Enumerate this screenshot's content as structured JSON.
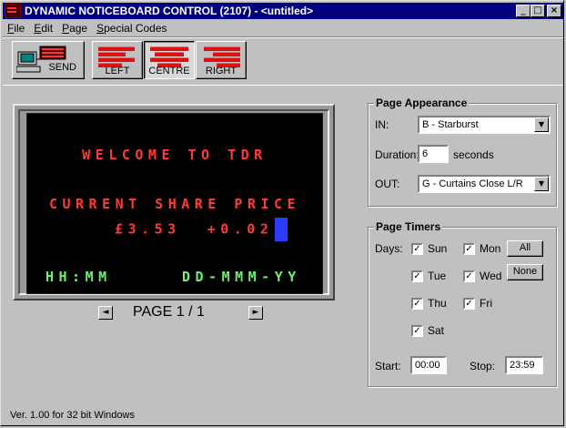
{
  "window": {
    "title": "DYNAMIC NOTICEBOARD CONTROL (2107) - <untitled>",
    "controls": [
      "_",
      "□",
      "×"
    ]
  },
  "menu": [
    {
      "label": "File",
      "accel": "F",
      "rest": "ile"
    },
    {
      "label": "Edit",
      "accel": "E",
      "rest": "dit"
    },
    {
      "label": "Page",
      "accel": "P",
      "rest": "age"
    },
    {
      "label": "Special Codes",
      "accel": "S",
      "rest": "pecial Codes"
    }
  ],
  "toolbar": {
    "send_label": "SEND",
    "left_label": "LEFT",
    "centre_label": "CENTRE",
    "right_label": "RIGHT",
    "active": "centre"
  },
  "display": {
    "line1": "WELCOME TO TDR",
    "line2": "CURRENT SHARE PRICE",
    "line3": "£3.53  +0.02",
    "line4_left": "HH:MM",
    "line4_right": "DD-MMM-YY",
    "colors": {
      "red": "#ff3a3a",
      "green": "#6ef06e",
      "cursor": "#2a3cff"
    }
  },
  "pager": {
    "label": "PAGE 1 / 1",
    "prev": "◄",
    "next": "►"
  },
  "appearance": {
    "title": "Page Appearance",
    "in_label": "IN:",
    "in_value": "B - Starburst",
    "duration_label": "Duration:",
    "duration_value": "6",
    "duration_unit": "seconds",
    "out_label": "OUT:",
    "out_value": "G - Curtains Close L/R",
    "dropdown_arrow": "▼"
  },
  "timers": {
    "title": "Page Timers",
    "days_label": "Days:",
    "days": {
      "sun": {
        "label": "Sun",
        "checked": true
      },
      "mon": {
        "label": "Mon",
        "checked": true
      },
      "tue": {
        "label": "Tue",
        "checked": true
      },
      "wed": {
        "label": "Wed",
        "checked": true
      },
      "thu": {
        "label": "Thu",
        "checked": true
      },
      "fri": {
        "label": "Fri",
        "checked": true
      },
      "sat": {
        "label": "Sat",
        "checked": true
      }
    },
    "check_mark": "✓",
    "all_label": "All",
    "none_label": "None",
    "start_label": "Start:",
    "start_value": "00:00",
    "stop_label": "Stop:",
    "stop_value": "23:59"
  },
  "status": "Ver. 1.00 for 32 bit Windows"
}
